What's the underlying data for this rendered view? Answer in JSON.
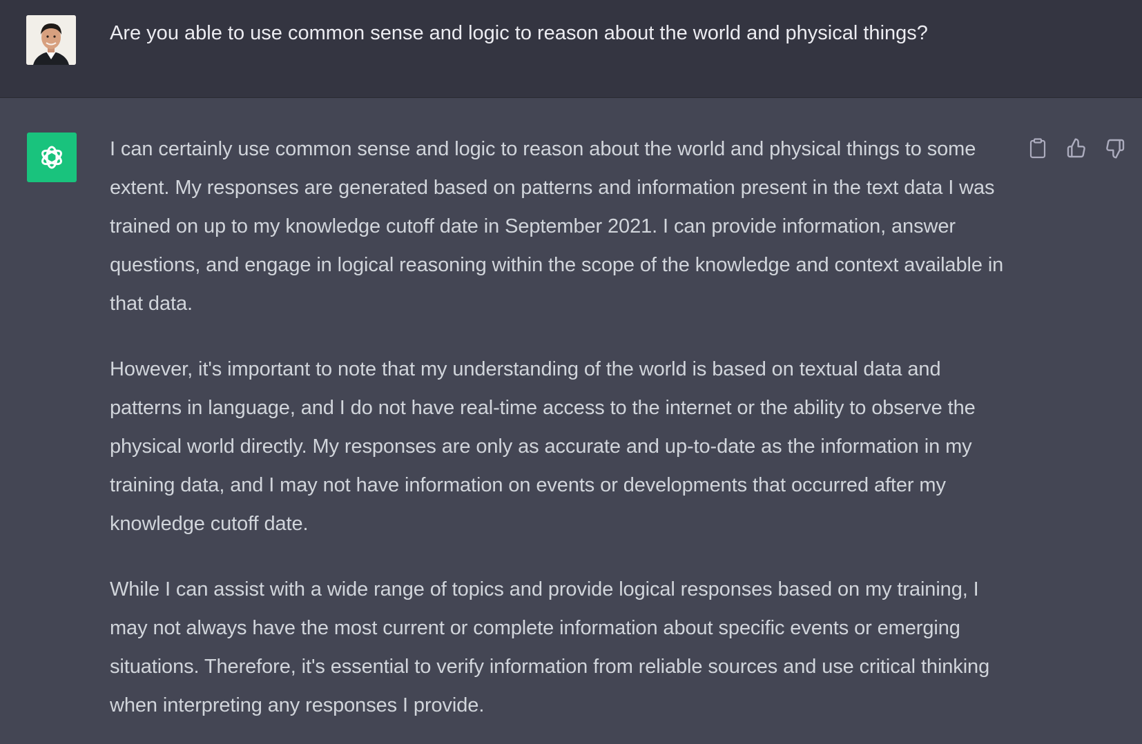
{
  "user": {
    "message": "Are you able to use common sense and logic to reason about the world and physical things?"
  },
  "assistant": {
    "paragraphs": [
      "I can certainly use common sense and logic to reason about the world and physical things to some extent. My responses are generated based on patterns and information present in the text data I was trained on up to my knowledge cutoff date in September 2021. I can provide information, answer questions, and engage in logical reasoning within the scope of the knowledge and context available in that data.",
      "However, it's important to note that my understanding of the world is based on textual data and patterns in language, and I do not have real-time access to the internet or the ability to observe the physical world directly. My responses are only as accurate and up-to-date as the information in my training data, and I may not have information on events or developments that occurred after my knowledge cutoff date.",
      "While I can assist with a wide range of topics and provide logical responses based on my training, I may not always have the most current or complete information about specific events or emerging situations. Therefore, it's essential to verify information from reliable sources and use critical thinking when interpreting any responses I provide."
    ]
  },
  "icons": {
    "copy": "clipboard-icon",
    "like": "thumbs-up-icon",
    "dislike": "thumbs-down-icon",
    "assistant_logo": "openai-logo-icon"
  },
  "colors": {
    "user_bg": "#343541",
    "assistant_bg": "#444654",
    "assistant_logo_bg": "#19c37d",
    "user_text": "#ececf1",
    "assistant_text": "#d1d5db",
    "icon": "#acacbe"
  }
}
